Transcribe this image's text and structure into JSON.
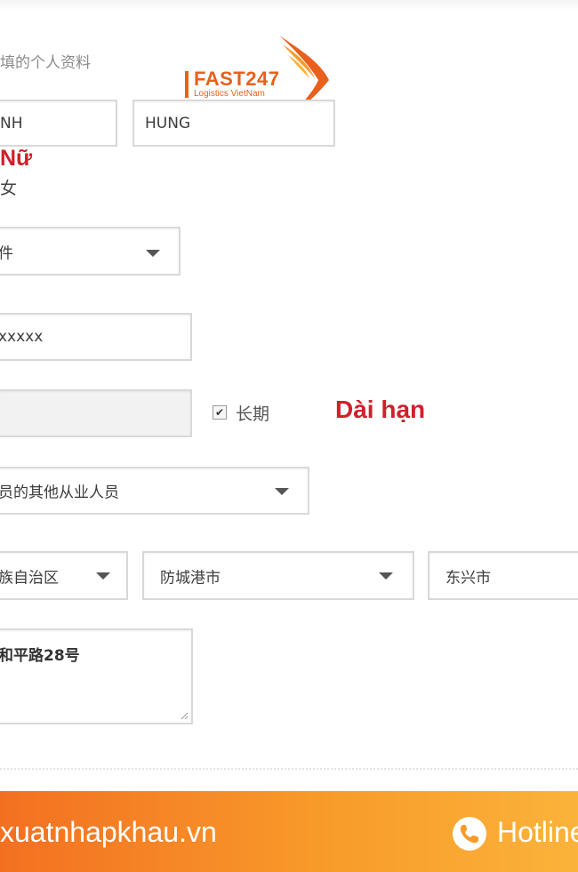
{
  "form": {
    "section_heading": "填的个人资料",
    "surname_value": "NH",
    "given_name_value": "HUNG",
    "gender_label_vi": "Nữ",
    "gender_label_cn": "女",
    "id_type_value": "件",
    "id_number_value": "xxxxx",
    "expiry_value": "",
    "longterm_label": "长期",
    "longterm_checked": true,
    "longterm_label_vi": "Dài hạn",
    "occupation_value": "员的其他从业人员",
    "province_value": "族自治区",
    "city_value": "防城港市",
    "county_value": "东兴市",
    "address_value": "和平路28号"
  },
  "logo": {
    "name": "FAST247",
    "tagline": "Logistics VietNam",
    "color": "#e8601c"
  },
  "footer": {
    "website": "xuatnhapkhau.vn",
    "hotline_label": "Hotline",
    "icon": "phone-icon",
    "gradient_start": "#f37021",
    "gradient_end": "#fbb33a"
  }
}
